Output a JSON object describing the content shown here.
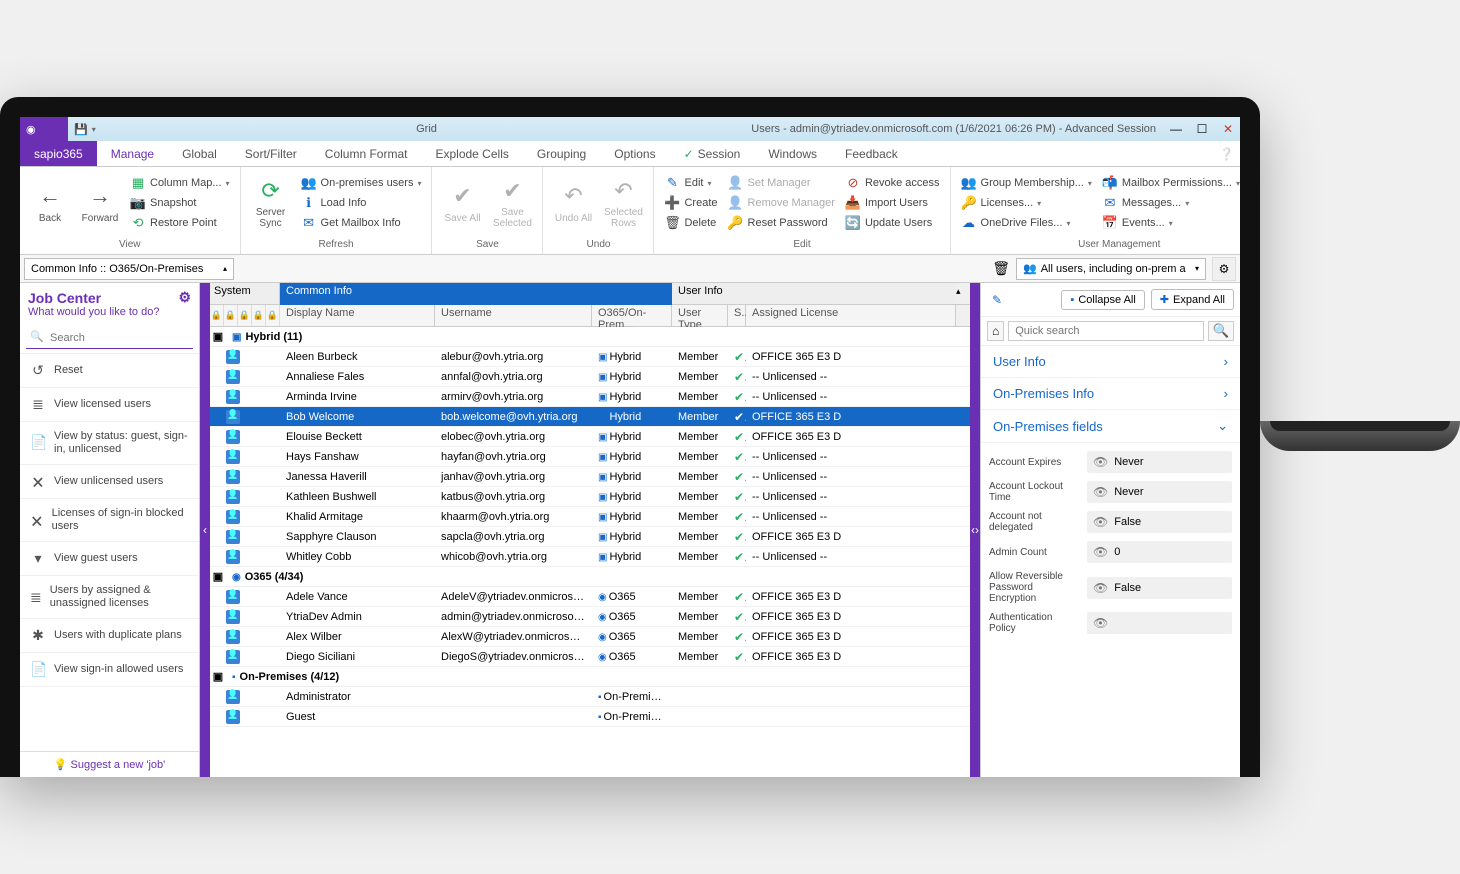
{
  "title": {
    "center": "Grid",
    "right": "Users - admin@ytriadev.onmicrosoft.com (1/6/2021 06:26 PM) - Advanced Session"
  },
  "tabs": {
    "brand": "sapio365",
    "items": [
      "Manage",
      "Global",
      "Sort/Filter",
      "Column Format",
      "Explode Cells",
      "Grouping",
      "Options",
      "Session",
      "Windows",
      "Feedback"
    ],
    "active": "Manage"
  },
  "ribbon": {
    "view": {
      "back": "Back",
      "forward": "Forward",
      "colmap": "Column Map...",
      "snapshot": "Snapshot",
      "restore": "Restore Point",
      "label": "View"
    },
    "refresh": {
      "sync": "Server\nSync",
      "onprem": "On-premises users",
      "load": "Load Info",
      "getmbx": "Get Mailbox Info",
      "label": "Refresh"
    },
    "save": {
      "saveall": "Save\nAll",
      "savesel": "Save\nSelected",
      "label": "Save"
    },
    "undo": {
      "undoall": "Undo\nAll",
      "selrows": "Selected\nRows",
      "label": "Undo"
    },
    "edit": {
      "edit": "Edit",
      "create": "Create",
      "delete": "Delete",
      "setmgr": "Set Manager",
      "remmgr": "Remove Manager",
      "resetpw": "Reset Password",
      "revoke": "Revoke access",
      "import": "Import Users",
      "update": "Update Users",
      "label": "Edit"
    },
    "usermgmt": {
      "group": "Group Membership...",
      "licenses": "Licenses...",
      "onedrive": "OneDrive Files...",
      "mailbox": "Mailbox Permissions...",
      "messages": "Messages...",
      "events": "Events...",
      "label": "User Management"
    }
  },
  "filter": {
    "left": "Common Info :: O365/On-Premises",
    "right": "All users, including on-prem a"
  },
  "jobcenter": {
    "title": "Job Center",
    "sub": "What would you like to do?",
    "search": "Search",
    "items": [
      {
        "icon": "↺",
        "label": "Reset"
      },
      {
        "icon": "≣",
        "label": "View licensed users"
      },
      {
        "icon": "📄",
        "label": "View by status: guest, sign-in, unlicensed"
      },
      {
        "icon": "🗙",
        "label": "View unlicensed users"
      },
      {
        "icon": "🗙",
        "label": "Licenses of sign-in blocked users"
      },
      {
        "icon": "▾",
        "label": "View guest users"
      },
      {
        "icon": "≣",
        "label": "Users by assigned & unassigned licenses"
      },
      {
        "icon": "✱",
        "label": "Users with duplicate plans"
      },
      {
        "icon": "📄",
        "label": "View sign-in allowed users"
      }
    ],
    "suggest": "Suggest a new 'job'"
  },
  "grid": {
    "h1": {
      "system": "System",
      "common": "Common Info",
      "user": "User Info"
    },
    "h2": {
      "name": "Display Name",
      "user": "Username",
      "prem": "O365/On-Prem...",
      "type": "User Type",
      "s": "S...",
      "lic": "Assigned License"
    },
    "groups": [
      {
        "title": "Hybrid (11)",
        "badge": "hybrid",
        "rows": [
          {
            "name": "Aleen Burbeck",
            "user": "alebur@ovh.ytria.org",
            "prem": "Hybrid",
            "type": "Member",
            "lic": "OFFICE 365 E3 D"
          },
          {
            "name": "Annaliese Fales",
            "user": "annfal@ovh.ytria.org",
            "prem": "Hybrid",
            "type": "Member",
            "lic": "-- Unlicensed --"
          },
          {
            "name": "Arminda Irvine",
            "user": "armirv@ovh.ytria.org",
            "prem": "Hybrid",
            "type": "Member",
            "lic": "-- Unlicensed --"
          },
          {
            "name": "Bob Welcome",
            "user": "bob.welcome@ovh.ytria.org",
            "prem": "Hybrid",
            "type": "Member",
            "lic": "OFFICE 365 E3 D",
            "sel": true
          },
          {
            "name": "Elouise Beckett",
            "user": "elobec@ovh.ytria.org",
            "prem": "Hybrid",
            "type": "Member",
            "lic": "OFFICE 365 E3 D"
          },
          {
            "name": "Hays Fanshaw",
            "user": "hayfan@ovh.ytria.org",
            "prem": "Hybrid",
            "type": "Member",
            "lic": "-- Unlicensed --"
          },
          {
            "name": "Janessa Haverill",
            "user": "janhav@ovh.ytria.org",
            "prem": "Hybrid",
            "type": "Member",
            "lic": "-- Unlicensed --"
          },
          {
            "name": "Kathleen Bushwell",
            "user": "katbus@ovh.ytria.org",
            "prem": "Hybrid",
            "type": "Member",
            "lic": "-- Unlicensed --"
          },
          {
            "name": "Khalid Armitage",
            "user": "khaarm@ovh.ytria.org",
            "prem": "Hybrid",
            "type": "Member",
            "lic": "-- Unlicensed --"
          },
          {
            "name": "Sapphyre Clauson",
            "user": "sapcla@ovh.ytria.org",
            "prem": "Hybrid",
            "type": "Member",
            "lic": "OFFICE 365 E3 D"
          },
          {
            "name": "Whitley Cobb",
            "user": "whicob@ovh.ytria.org",
            "prem": "Hybrid",
            "type": "Member",
            "lic": "-- Unlicensed --"
          }
        ]
      },
      {
        "title": "O365 (4/34)",
        "badge": "o365",
        "rows": [
          {
            "name": "Adele Vance",
            "user": "AdeleV@ytriadev.onmicrosoft.co",
            "prem": "O365",
            "type": "Member",
            "lic": "OFFICE 365 E3 D"
          },
          {
            "name": "YtriaDev Admin",
            "user": "admin@ytriadev.onmicrosoft.co",
            "prem": "O365",
            "type": "Member",
            "lic": "OFFICE 365 E3 D"
          },
          {
            "name": "Alex Wilber",
            "user": "AlexW@ytriadev.onmicrosoft.co",
            "prem": "O365",
            "type": "Member",
            "lic": "OFFICE 365 E3 D"
          },
          {
            "name": "Diego Siciliani",
            "user": "DiegoS@ytriadev.onmicrosoft.cc",
            "prem": "O365",
            "type": "Member",
            "lic": "OFFICE 365 E3 D"
          }
        ]
      },
      {
        "title": "On-Premises (4/12)",
        "badge": "onprem",
        "rows": [
          {
            "name": "Administrator",
            "user": "",
            "prem": "On-Premises",
            "type": "",
            "lic": ""
          },
          {
            "name": "Guest",
            "user": "",
            "prem": "On-Premises",
            "type": "",
            "lic": ""
          }
        ]
      }
    ]
  },
  "details": {
    "collapse": "Collapse All",
    "expand": "Expand All",
    "search": "Quick search",
    "sections": [
      {
        "title": "User Info",
        "open": false
      },
      {
        "title": "On-Premises Info",
        "open": false
      },
      {
        "title": "On-Premises fields",
        "open": true,
        "fields": [
          {
            "label": "Account Expires",
            "value": "Never"
          },
          {
            "label": "Account Lockout Time",
            "value": "Never"
          },
          {
            "label": "Account not delegated",
            "value": "False"
          },
          {
            "label": "Admin Count",
            "value": "0"
          },
          {
            "label": "Allow Reversible Password Encryption",
            "value": "False"
          },
          {
            "label": "Authentication Policy",
            "value": ""
          }
        ]
      }
    ]
  }
}
